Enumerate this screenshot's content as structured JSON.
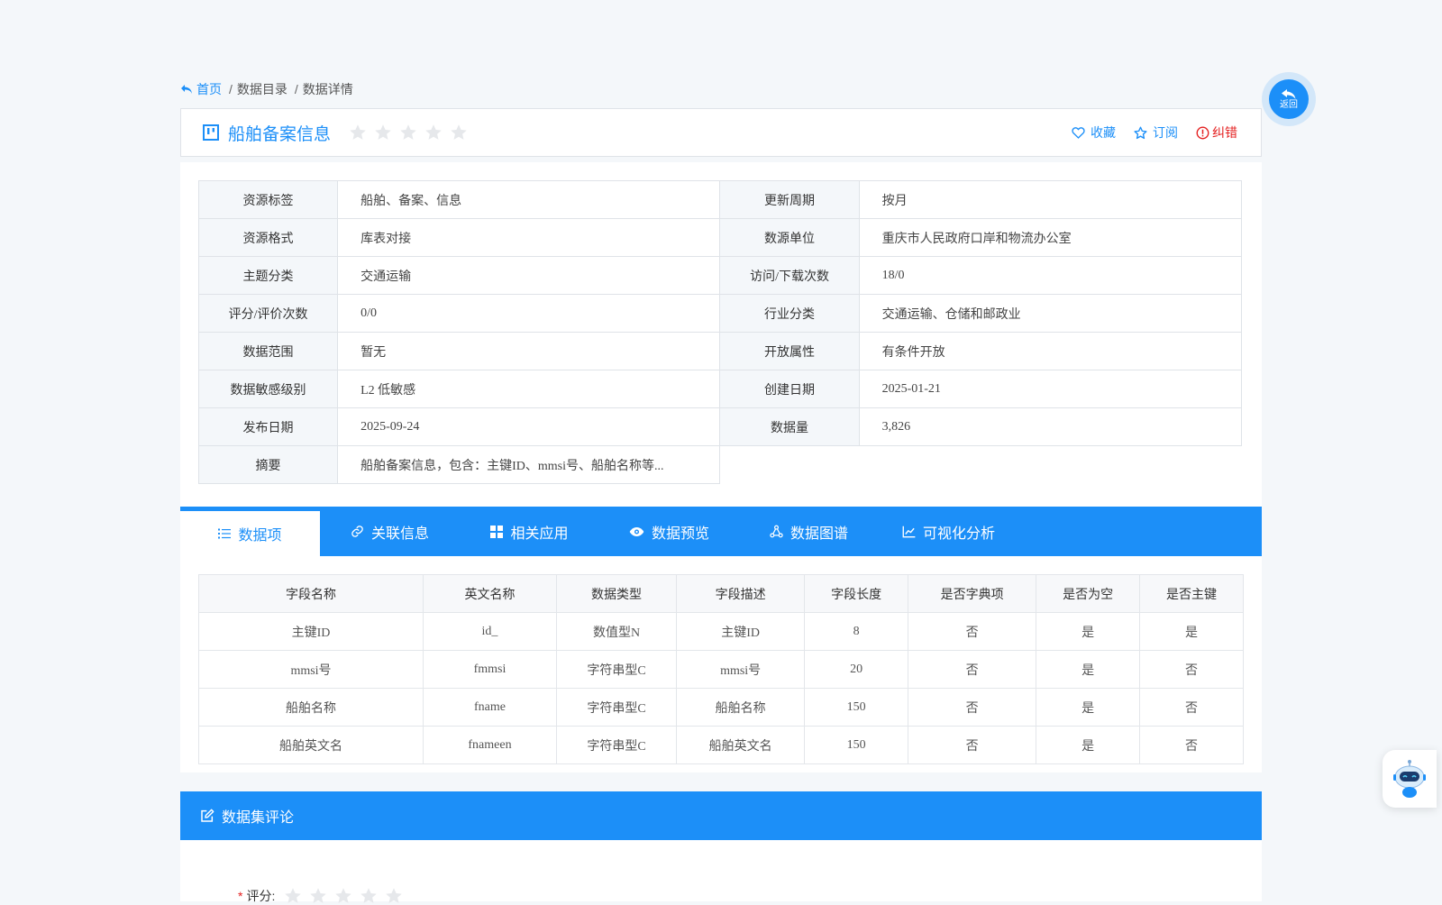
{
  "breadcrumb": {
    "home": "首页",
    "items": [
      "数据目录",
      "数据详情"
    ],
    "separator": "/"
  },
  "back_button": {
    "label": "返回"
  },
  "title_bar": {
    "title": "船舶备案信息",
    "rating_stars": 5,
    "actions": {
      "favorite": "收藏",
      "subscribe": "订阅",
      "report_error": "纠错"
    }
  },
  "info": {
    "rows": [
      [
        {
          "k": "资源标签",
          "v": "船舶、备案、信息"
        },
        {
          "k": "更新周期",
          "v": "按月"
        }
      ],
      [
        {
          "k": "资源格式",
          "v": "库表对接"
        },
        {
          "k": "数源单位",
          "v": "重庆市人民政府口岸和物流办公室"
        }
      ],
      [
        {
          "k": "主题分类",
          "v": "交通运输"
        },
        {
          "k": "访问/下载次数",
          "v": "18/0"
        }
      ],
      [
        {
          "k": "评分/评价次数",
          "v": "0/0"
        },
        {
          "k": "行业分类",
          "v": "交通运输、仓储和邮政业"
        }
      ],
      [
        {
          "k": "数据范围",
          "v": "暂无"
        },
        {
          "k": "开放属性",
          "v": "有条件开放"
        }
      ],
      [
        {
          "k": "数据敏感级别",
          "v": "L2 低敏感"
        },
        {
          "k": "创建日期",
          "v": "2025-01-21"
        }
      ],
      [
        {
          "k": "发布日期",
          "v": "2025-09-24"
        },
        {
          "k": "数据量",
          "v": "3,826"
        }
      ],
      [
        {
          "k": "摘要",
          "v": "船舶备案信息，包含：主键ID、mmsi号、船舶名称等..."
        }
      ]
    ]
  },
  "tabs": [
    {
      "label": "数据项",
      "icon": "list-icon",
      "active": true
    },
    {
      "label": "关联信息",
      "icon": "link-icon",
      "active": false
    },
    {
      "label": "相关应用",
      "icon": "grid-icon",
      "active": false
    },
    {
      "label": "数据预览",
      "icon": "eye-icon",
      "active": false
    },
    {
      "label": "数据图谱",
      "icon": "graph-icon",
      "active": false
    },
    {
      "label": "可视化分析",
      "icon": "line-chart-icon",
      "active": false
    }
  ],
  "fields_table": {
    "headers": [
      "字段名称",
      "英文名称",
      "数据类型",
      "字段描述",
      "字段长度",
      "是否字典项",
      "是否为空",
      "是否主键"
    ],
    "rows": [
      [
        "主键ID",
        "id_",
        "数值型N",
        "主键ID",
        "8",
        "否",
        "是",
        "是"
      ],
      [
        "mmsi号",
        "fmmsi",
        "字符串型C",
        "mmsi号",
        "20",
        "否",
        "是",
        "否"
      ],
      [
        "船舶名称",
        "fname",
        "字符串型C",
        "船舶名称",
        "150",
        "否",
        "是",
        "否"
      ],
      [
        "船舶英文名",
        "fnameen",
        "字符串型C",
        "船舶英文名",
        "150",
        "否",
        "是",
        "否"
      ]
    ]
  },
  "comments": {
    "title": "数据集评论",
    "rating_required_mark": "*",
    "rating_label": "评分:"
  },
  "colors": {
    "primary": "#1c8ff8",
    "danger": "#e42020",
    "star_empty": "#e6e8eb",
    "page_bg": "#f4f7fa"
  }
}
